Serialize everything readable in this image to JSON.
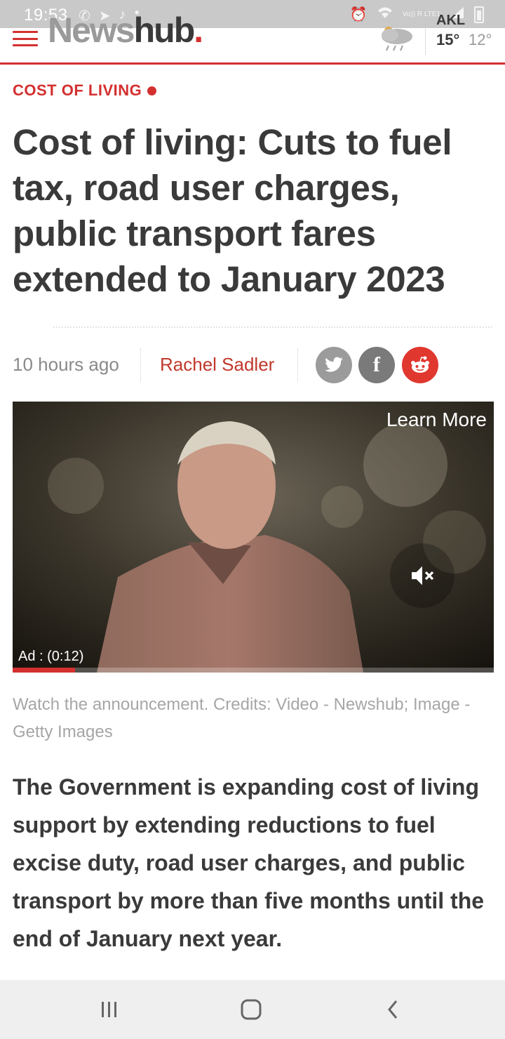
{
  "status_bar": {
    "time": "19:53",
    "left_icons": [
      "whatsapp-icon",
      "telegram-icon",
      "tiktok-icon",
      "dot-icon"
    ],
    "right_icons": [
      "alarm-icon",
      "wifi-icon",
      "volte-icon",
      "signal-icon",
      "battery-icon"
    ],
    "volte_text": "Vo)) R LTE1"
  },
  "header": {
    "logo_part1": "News",
    "logo_part2": "hub",
    "logo_dot": ".",
    "weather": {
      "city": "AKL",
      "high": "15°",
      "low": "12°",
      "icon": "rain-cloud-icon"
    }
  },
  "article": {
    "section": "COST OF LIVING",
    "headline": "Cost of living: Cuts to fuel tax, road user charges, public transport fares extended to January 2023",
    "time_ago": "10 hours ago",
    "author": "Rachel Sadler",
    "share_icons": [
      "twitter-icon",
      "facebook-icon",
      "reddit-icon"
    ],
    "video": {
      "learn_more": "Learn More",
      "ad_label": "Ad : (0:12)",
      "muted": true,
      "progress": 0.13
    },
    "caption": "Watch the announcement. Credits: Video - Newshub; Image - Getty Images",
    "body": "The Government is expanding cost of living support by extending reductions to fuel excise duty, road user charges, and public transport by more than five months until the end of January next year."
  },
  "nav_bar": {
    "buttons": [
      "recent-apps",
      "home",
      "back"
    ]
  },
  "colors": {
    "brand_red": "#d3302f",
    "text_dark": "#3a3a3a",
    "text_grey": "#8a8a8a"
  }
}
